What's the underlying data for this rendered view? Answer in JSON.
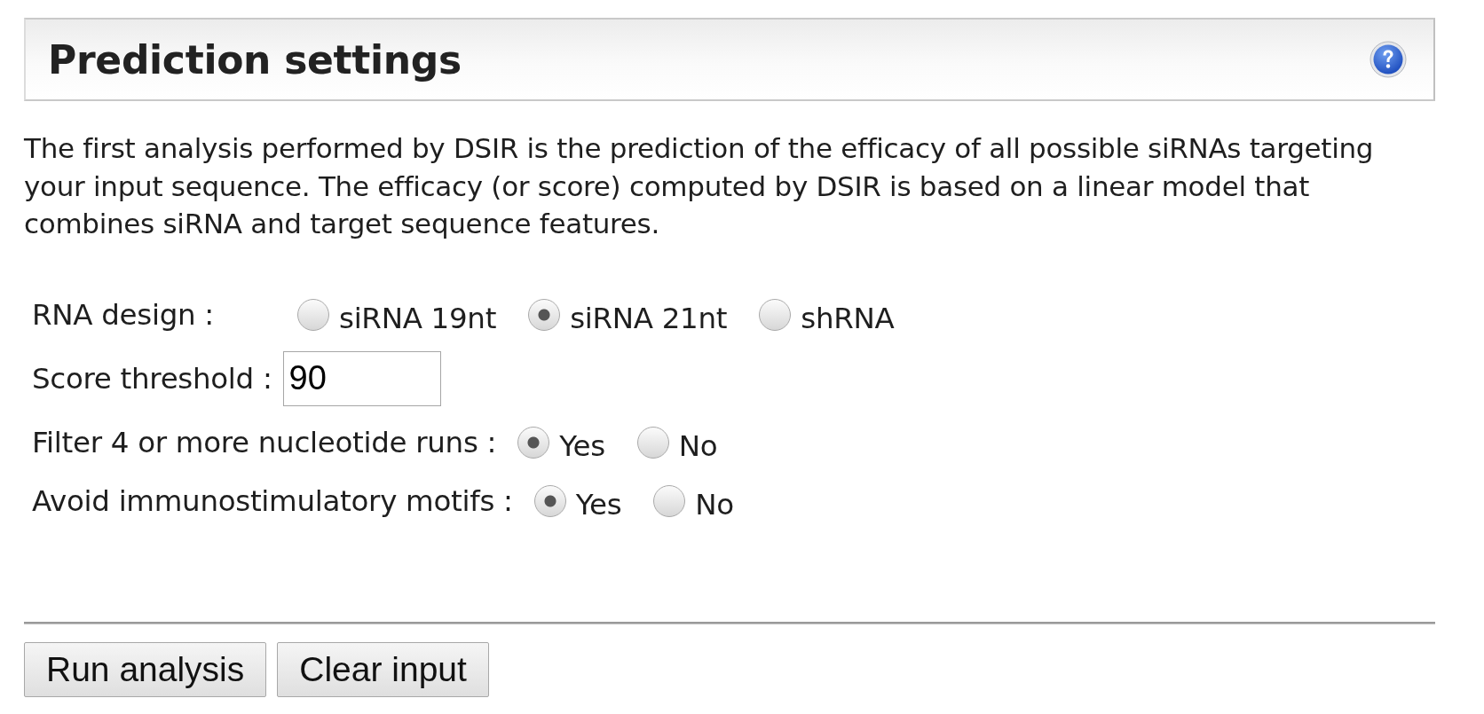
{
  "panel": {
    "title": "Prediction settings"
  },
  "description": "The first analysis performed by DSIR is the prediction of the efficacy of all possible siRNAs targeting your input sequence. The efficacy (or score) computed by DSIR is based on a linear model that combines siRNA and target sequence features.",
  "settings": [
    {
      "kind": "radio",
      "label": "RNA design :",
      "options": [
        {
          "label": "siRNA 19nt",
          "selected": false
        },
        {
          "label": "siRNA 21nt",
          "selected": true
        },
        {
          "label": "shRNA",
          "selected": false
        }
      ]
    },
    {
      "kind": "text",
      "label": "Score threshold :",
      "value": "90"
    },
    {
      "kind": "radio",
      "label": "Filter 4 or more nucleotide runs :",
      "options": [
        {
          "label": "Yes",
          "selected": true
        },
        {
          "label": "No",
          "selected": false
        }
      ]
    },
    {
      "kind": "radio",
      "label": "Avoid immunostimulatory motifs :",
      "options": [
        {
          "label": "Yes",
          "selected": true
        },
        {
          "label": "No",
          "selected": false
        }
      ]
    }
  ],
  "buttons": [
    "Run analysis",
    "Clear input"
  ]
}
